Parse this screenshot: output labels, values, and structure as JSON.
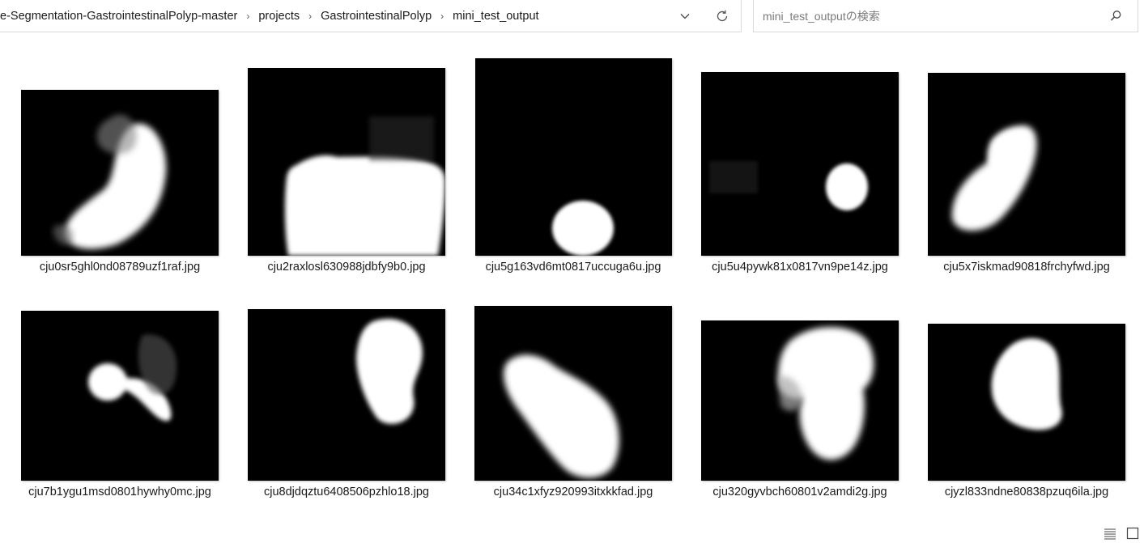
{
  "address_bar": {
    "breadcrumbs": [
      "e-Segmentation-GastrointestinalPolyp-master",
      "projects",
      "GastrointestinalPolyp",
      "mini_test_output"
    ]
  },
  "search": {
    "placeholder": "mini_test_outputの検索",
    "value": ""
  },
  "files": [
    {
      "name": "cju0sr5ghl0nd08789uzf1raf.jpg"
    },
    {
      "name": "cju2raxlosl630988jdbfy9b0.jpg"
    },
    {
      "name": "cju5g163vd6mt0817uccuga6u.jpg"
    },
    {
      "name": "cju5u4pywk81x0817vn9pe14z.jpg"
    },
    {
      "name": "cju5x7iskmad90818frchyfwd.jpg"
    },
    {
      "name": "cju7b1ygu1msd0801hywhy0mc.jpg"
    },
    {
      "name": "cju8djdqztu6408506pzhlo18.jpg"
    },
    {
      "name": "cju34c1xfyz920993itxkkfad.jpg"
    },
    {
      "name": "cju320gyvbch60801v2amdi2g.jpg"
    },
    {
      "name": "cjyzl833ndne80838pzuq6ila.jpg"
    }
  ],
  "icons": {
    "breadcrumb_separator": "chevron-right-icon",
    "dropdown": "chevron-down-icon",
    "refresh": "refresh-icon",
    "search": "search-icon",
    "details_view": "details-view-icon",
    "large_icons_view": "large-icons-view-icon"
  },
  "colors": {
    "mask_background": "#000000",
    "mask_foreground": "#ffffff"
  }
}
